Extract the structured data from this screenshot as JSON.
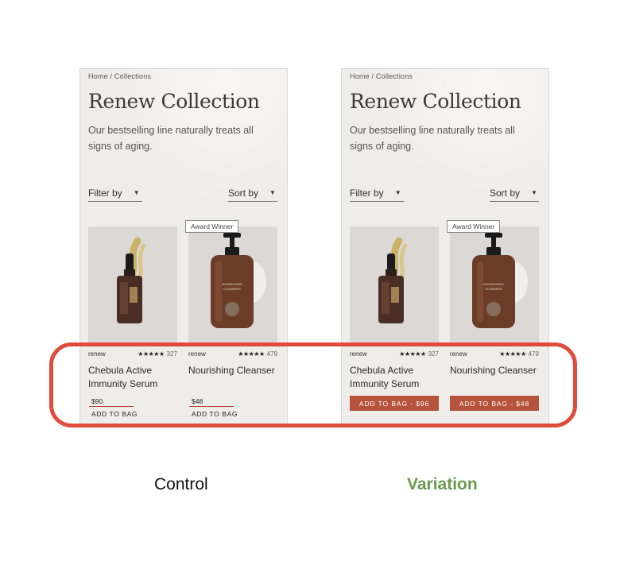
{
  "colors": {
    "page_bg": "#efedea",
    "product_tile_bg": "#dcd8d5",
    "cta_button": "#b5533c",
    "highlight": "#e04b3b",
    "price_rule": "#c0392b",
    "variation_caption": "#6a9a4e"
  },
  "panels": [
    {
      "breadcrumb": "Home / Collections",
      "title": "Renew Collection",
      "description": "Our bestselling line naturally treats all signs of aging.",
      "filter_label": "Filter by",
      "sort_label": "Sort by",
      "badge": "Award Winner",
      "products": [
        {
          "brand": "renew",
          "stars": "★★★★★",
          "reviews": "327",
          "name": "Chebula Active Immunity Serum",
          "price": "$90",
          "cta": "ADD TO BAG"
        },
        {
          "brand": "renew",
          "stars": "★★★★★",
          "reviews": "479",
          "name": "Nourishing Cleanser",
          "price": "$48",
          "cta": "ADD TO BAG"
        }
      ]
    },
    {
      "breadcrumb": "Home / Collections",
      "title": "Renew Collection",
      "description": "Our bestselling line naturally treats all signs of aging.",
      "filter_label": "Filter by",
      "sort_label": "Sort by",
      "badge": "Award Winner",
      "products": [
        {
          "brand": "renew",
          "stars": "★★★★★",
          "reviews": "327",
          "name": "Chebula Active Immunity Serum",
          "cta": "ADD TO BAG - $96"
        },
        {
          "brand": "renew",
          "stars": "★★★★★",
          "reviews": "479",
          "name": "Nourishing Cleanser",
          "cta": "ADD TO BAG - $48"
        }
      ]
    }
  ],
  "captions": {
    "control": "Control",
    "variation": "Variation"
  },
  "icons": [
    "caret-down-icon",
    "star-icon",
    "serum-bottle-icon",
    "pump-bottle-icon"
  ]
}
